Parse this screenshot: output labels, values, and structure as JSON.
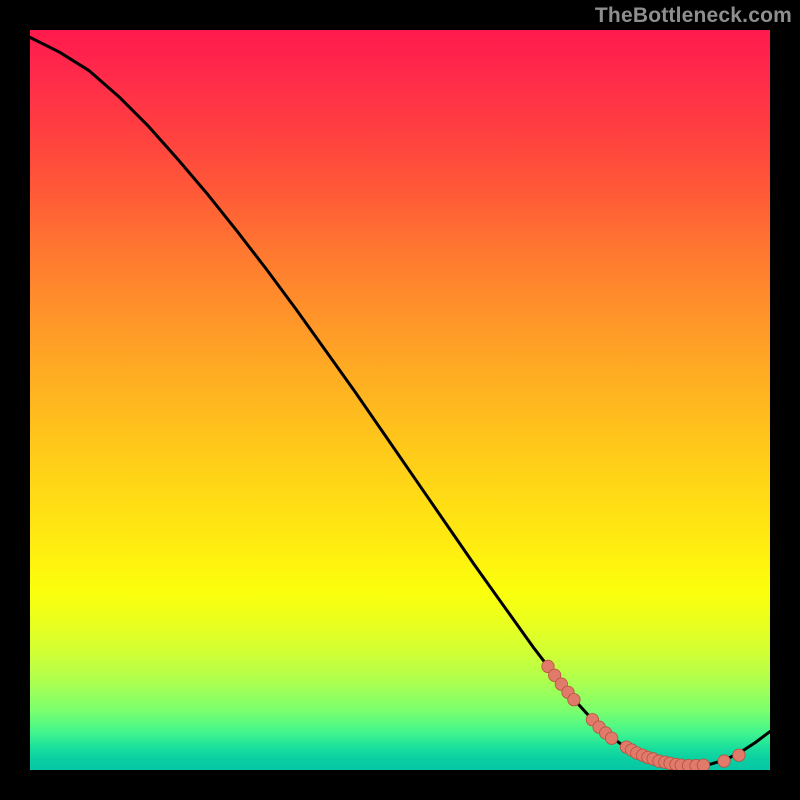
{
  "watermark": {
    "text": "TheBottleneck.com"
  },
  "colors": {
    "line": "#000000",
    "marker_fill": "#e07a6a",
    "marker_stroke": "#bb4f3d"
  },
  "chart_data": {
    "type": "line",
    "title": "",
    "xlabel": "",
    "ylabel": "",
    "xlim": [
      0,
      100
    ],
    "ylim": [
      0,
      100
    ],
    "grid": false,
    "legend": false,
    "notes": "Chart has no axis labels or tick marks. X and Y are normalized 0–100. Background is a red→yellow→green vertical gradient. Curve starts at top-left (~0,99), descends steeply to a minimum near x≈88, then rises slightly toward x=100.",
    "series": [
      {
        "name": "curve",
        "type": "line",
        "stroke": "#000000",
        "x": [
          0,
          4,
          8,
          12,
          16,
          20,
          24,
          28,
          32,
          36,
          40,
          44,
          48,
          52,
          56,
          60,
          64,
          68,
          70,
          72,
          74,
          76,
          78,
          80,
          82,
          84,
          86,
          88,
          90,
          92,
          94,
          96,
          98,
          100
        ],
        "values": [
          99,
          97,
          94.5,
          91,
          87,
          82.5,
          77.8,
          72.8,
          67.6,
          62.2,
          56.6,
          51,
          45.2,
          39.4,
          33.6,
          27.8,
          22.2,
          16.6,
          14,
          11.4,
          9,
          6.8,
          4.9,
          3.4,
          2.3,
          1.5,
          0.9,
          0.6,
          0.6,
          0.8,
          1.4,
          2.4,
          3.7,
          5.2
        ]
      },
      {
        "name": "data-points",
        "type": "scatter",
        "marker_color": "#e07a6a",
        "x": [
          70.0,
          70.9,
          71.8,
          72.7,
          73.5,
          76.0,
          76.9,
          77.8,
          78.6,
          80.6,
          81.3,
          82.0,
          82.8,
          83.5,
          84.2,
          85.0,
          85.8,
          86.5,
          87.3,
          88.0,
          89.0,
          90.0,
          91.0,
          93.8,
          95.8
        ],
        "values": [
          14.0,
          12.8,
          11.6,
          10.5,
          9.5,
          6.8,
          5.8,
          5.0,
          4.3,
          3.1,
          2.7,
          2.3,
          2.0,
          1.7,
          1.5,
          1.2,
          1.05,
          0.9,
          0.75,
          0.65,
          0.6,
          0.6,
          0.65,
          1.2,
          2.0
        ]
      }
    ]
  }
}
